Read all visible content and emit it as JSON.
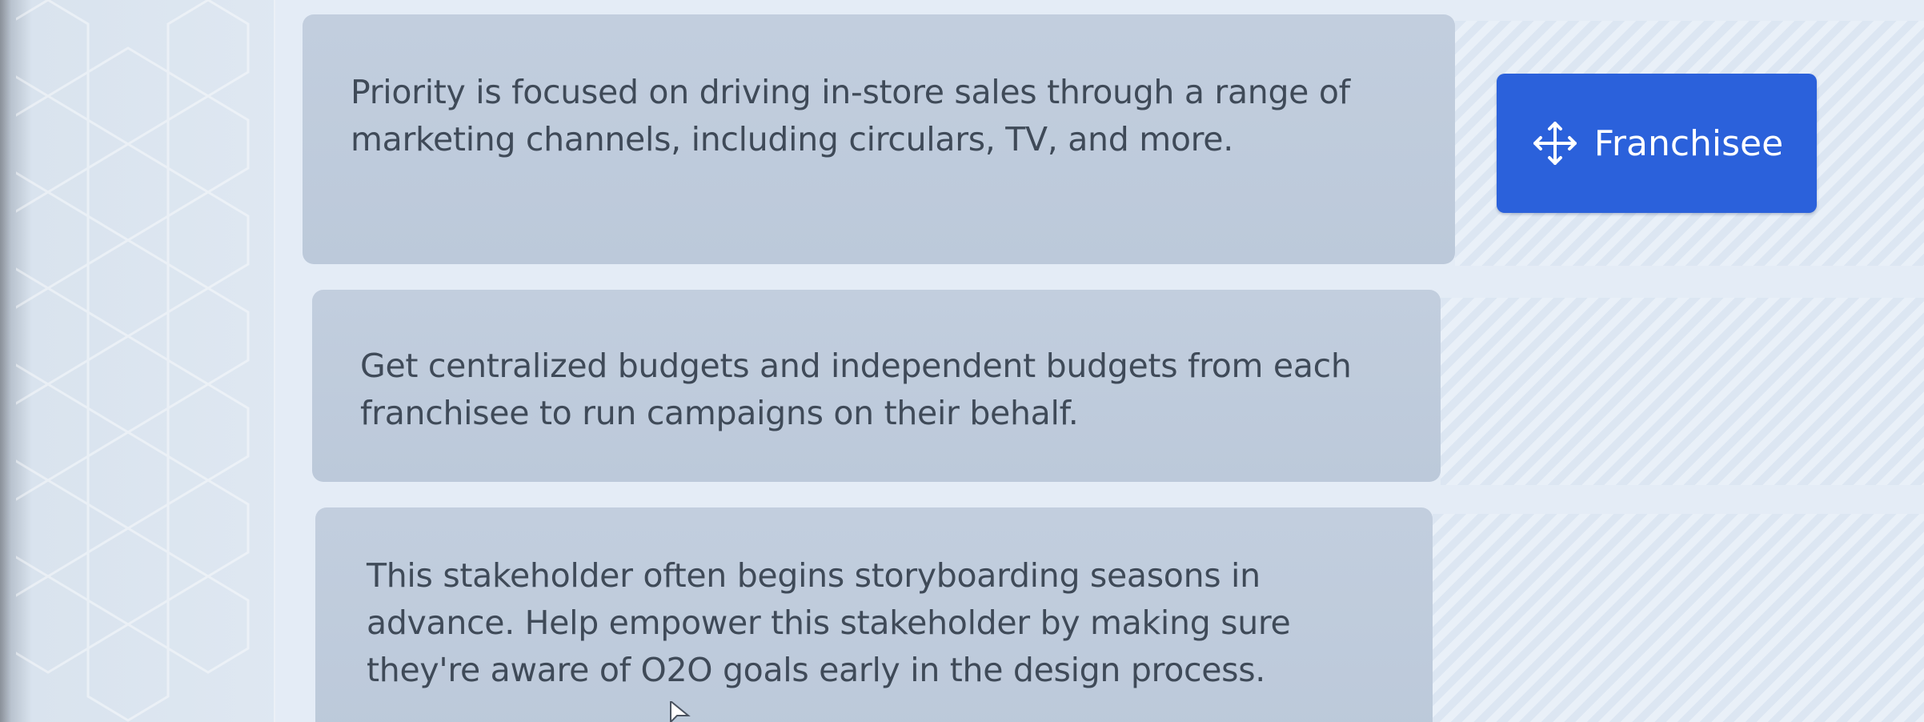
{
  "statements": [
    {
      "text_lines": [
        "Priority is focused on driving in-store sales through a range of",
        "marketing channels, including circulars, TV, and more."
      ]
    },
    {
      "text_lines": [
        "Get centralized budgets and independent budgets from each",
        "franchisee to run campaigns on their behalf."
      ]
    },
    {
      "text_lines": [
        "This stakeholder often begins storyboarding seasons in",
        "advance. Help empower this stakeholder by making sure",
        "they're aware of O2O goals early in the design process."
      ]
    }
  ],
  "answer_chip": {
    "label": "Franchisee",
    "icon": "move-arrows-icon",
    "color": "#2b61db"
  }
}
